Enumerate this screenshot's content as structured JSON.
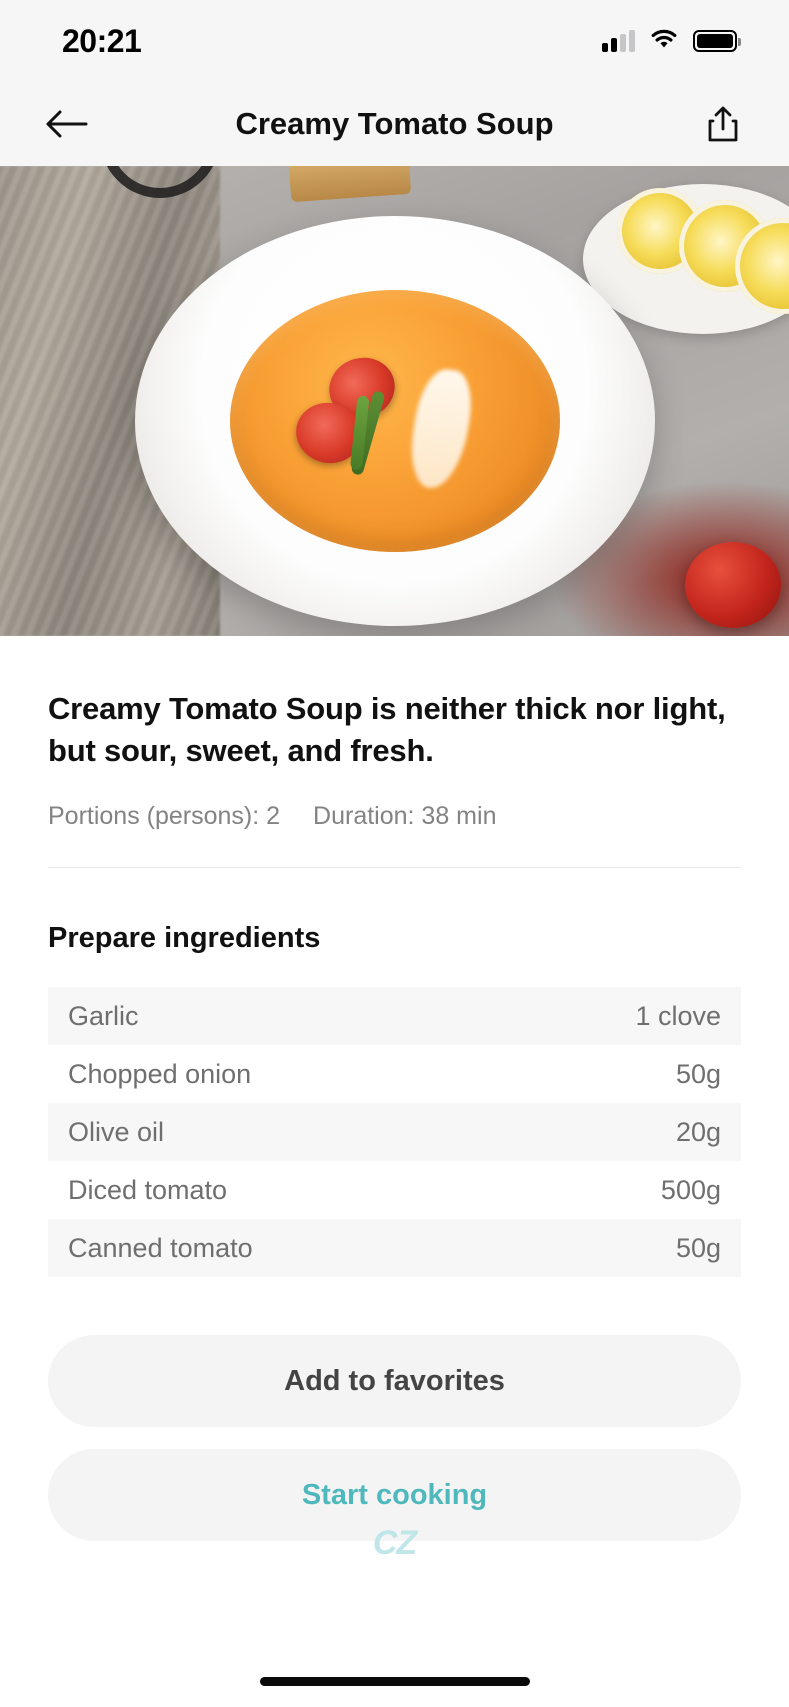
{
  "status_bar": {
    "time": "20:21",
    "signal_icon": "cellular-signal-icon",
    "wifi_icon": "wifi-icon",
    "battery_icon": "battery-full-icon"
  },
  "nav_bar": {
    "back_icon": "back-arrow-icon",
    "title": "Creamy Tomato Soup",
    "share_icon": "share-icon"
  },
  "hero": {
    "alt": "creamy-tomato-soup-photo"
  },
  "recipe": {
    "description": "Creamy Tomato Soup is neither thick nor light, but sour, sweet, and fresh.",
    "portions_label": "Portions (persons): 2",
    "duration_label": "Duration: 38 min"
  },
  "ingredients_section": {
    "title": "Prepare ingredients",
    "items": [
      {
        "name": "Garlic",
        "qty": "1 clove"
      },
      {
        "name": "Chopped onion",
        "qty": "50g"
      },
      {
        "name": "Olive oil",
        "qty": "20g"
      },
      {
        "name": "Diced tomato",
        "qty": "500g"
      },
      {
        "name": "Canned tomato",
        "qty": "50g"
      }
    ]
  },
  "actions": {
    "favorite_label": "Add to favorites",
    "start_label": "Start cooking",
    "watermark": "CZ"
  },
  "colors": {
    "accent": "#4fb8bd",
    "watermark": "#bfe6e8",
    "row_alt": "#f7f7f7",
    "chrome": "#f6f6f6"
  }
}
